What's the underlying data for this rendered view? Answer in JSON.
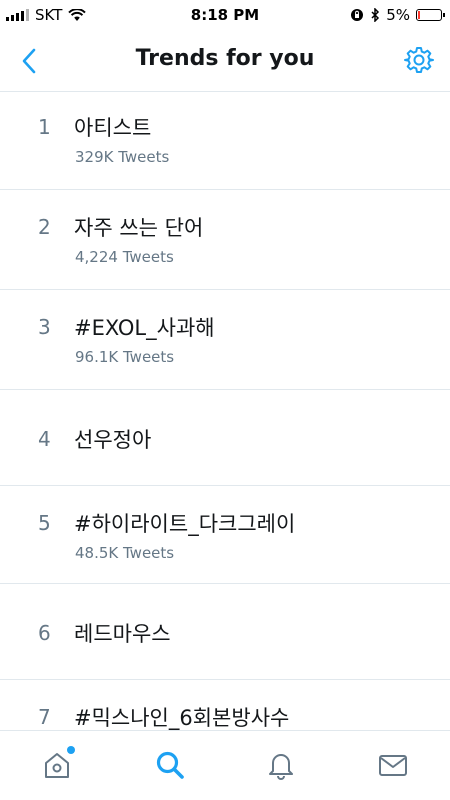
{
  "status_bar": {
    "carrier": "SKT",
    "time": "8:18 PM",
    "battery_text": "5%",
    "battery_level": 0.05,
    "battery_color": "#ff3b30"
  },
  "header": {
    "title": "Trends for you",
    "back_icon": "chevron-left-icon",
    "settings_icon": "gear-icon"
  },
  "trends": [
    {
      "rank": "1",
      "name": "아티스트",
      "count": "329K Tweets"
    },
    {
      "rank": "2",
      "name": "자주 쓰는 단어",
      "count": "4,224 Tweets"
    },
    {
      "rank": "3",
      "name": "#EXOL_사과해",
      "count": "96.1K Tweets"
    },
    {
      "rank": "4",
      "name": "선우정아",
      "count": ""
    },
    {
      "rank": "5",
      "name": "#하이라이트_다크그레이",
      "count": "48.5K Tweets"
    },
    {
      "rank": "6",
      "name": "레드마우스",
      "count": ""
    },
    {
      "rank": "7",
      "name": "#믹스나인_6회본방사수",
      "count": ""
    }
  ],
  "tab_bar": {
    "tabs": [
      "home-icon",
      "search-icon",
      "notifications-bell-icon",
      "messages-envelope-icon"
    ],
    "active": "search-icon"
  },
  "colors": {
    "accent": "#1da1f2",
    "text_primary": "#14171a",
    "text_secondary": "#657786",
    "divider": "#e1e8ed"
  }
}
